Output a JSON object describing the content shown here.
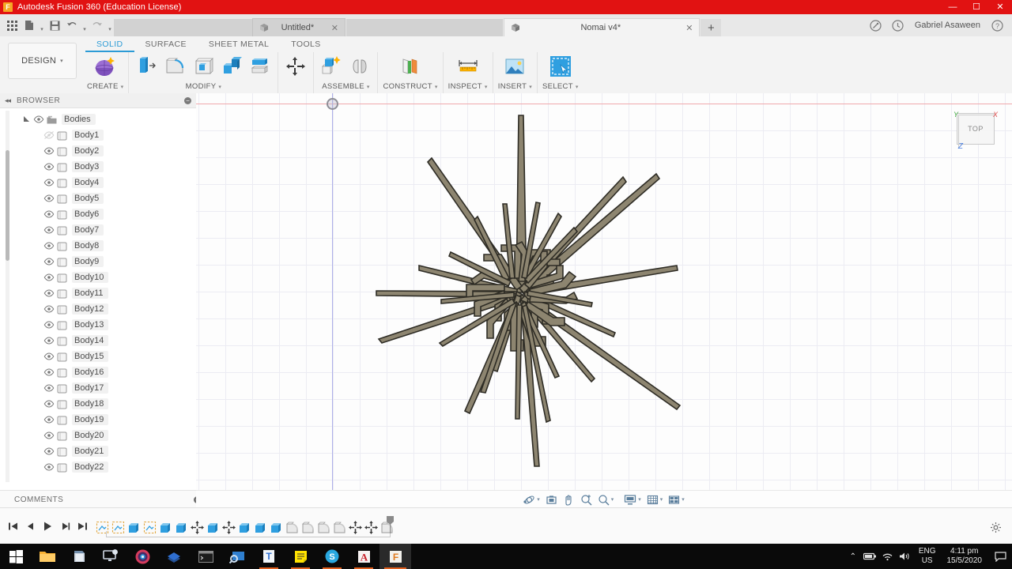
{
  "titlebar": {
    "app_title": "Autodesk Fusion 360 (Education License)",
    "app_icon": "fusion-logo-icon",
    "minimize": "—",
    "maximize": "☐",
    "close": "✕",
    "bg_color": "#e11212"
  },
  "quick_access": {
    "grid_menu": "grid-menu-icon",
    "file_label": "file-icon",
    "save_label": "save-icon",
    "undo_label": "undo-icon",
    "redo_label": "redo-icon",
    "tabs": [
      {
        "label": "Untitled*",
        "close": "✕",
        "active": false
      },
      {
        "label": "Nomai v4*",
        "close": "✕",
        "active": true
      }
    ],
    "new_tab": "+",
    "extensions_icon": "extensions-icon",
    "job_status_icon": "job-status-icon",
    "username": "Gabriel Asaween",
    "help_icon": "help-icon"
  },
  "ribbon": {
    "workspace": "DESIGN",
    "workspace_caret": "▾",
    "tabs": [
      {
        "label": "SOLID",
        "active": true
      },
      {
        "label": "SURFACE",
        "active": false
      },
      {
        "label": "SHEET METAL",
        "active": false
      },
      {
        "label": "TOOLS",
        "active": false
      }
    ],
    "panels": [
      {
        "label": "CREATE",
        "caret": "▾",
        "icons": [
          "create-sphere-icon"
        ]
      },
      {
        "label": "MODIFY",
        "caret": "▾",
        "icons": [
          "press-pull-icon",
          "fillet-icon",
          "shell-icon",
          "combine-icon",
          "split-body-icon"
        ]
      },
      {
        "label": "",
        "caret": "",
        "icons": [
          "move-copy-icon"
        ]
      },
      {
        "label": "ASSEMBLE",
        "caret": "▾",
        "icons": [
          "new-component-icon",
          "joint-icon"
        ]
      },
      {
        "label": "CONSTRUCT",
        "caret": "▾",
        "icons": [
          "offset-plane-icon"
        ]
      },
      {
        "label": "INSPECT",
        "caret": "▾",
        "icons": [
          "measure-icon"
        ]
      },
      {
        "label": "INSERT",
        "caret": "▾",
        "icons": [
          "insert-image-icon"
        ]
      },
      {
        "label": "SELECT",
        "caret": "▾",
        "icons": [
          "select-window-icon"
        ]
      }
    ],
    "accent_color": "#2c9bd6"
  },
  "browser": {
    "title": "BROWSER",
    "collapse_icon": "◂◂",
    "settings_icon": "⊖",
    "root": {
      "label": "Bodies",
      "expand_icon": "expand-triangle-icon",
      "eye_icon": "eye-icon",
      "folder_icon": "folder-icon"
    },
    "bodies": [
      {
        "label": "Body1",
        "visible": false
      },
      {
        "label": "Body2",
        "visible": true
      },
      {
        "label": "Body3",
        "visible": true
      },
      {
        "label": "Body4",
        "visible": true
      },
      {
        "label": "Body5",
        "visible": true
      },
      {
        "label": "Body6",
        "visible": true
      },
      {
        "label": "Body7",
        "visible": true
      },
      {
        "label": "Body8",
        "visible": true
      },
      {
        "label": "Body9",
        "visible": true
      },
      {
        "label": "Body10",
        "visible": true
      },
      {
        "label": "Body11",
        "visible": true
      },
      {
        "label": "Body12",
        "visible": true
      },
      {
        "label": "Body13",
        "visible": true
      },
      {
        "label": "Body14",
        "visible": true
      },
      {
        "label": "Body15",
        "visible": true
      },
      {
        "label": "Body16",
        "visible": true
      },
      {
        "label": "Body17",
        "visible": true
      },
      {
        "label": "Body18",
        "visible": true
      },
      {
        "label": "Body19",
        "visible": true
      },
      {
        "label": "Body20",
        "visible": true
      },
      {
        "label": "Body21",
        "visible": true
      },
      {
        "label": "Body22",
        "visible": true
      }
    ]
  },
  "comments": {
    "title": "COMMENTS",
    "add_icon": "+"
  },
  "canvas": {
    "view_cube_label": "TOP",
    "axis_x_label": "X",
    "axis_y_label": "Y",
    "axis_z_label": "Z",
    "axis_x_color": "#e05050",
    "axis_y_color": "#3faa3f",
    "axis_z_color": "#4a7fe0",
    "grid_color": "#ececf3",
    "model_fill": "#8d8570",
    "model_stroke": "#3a372e",
    "model_name": "nomai-radial-glyph"
  },
  "navbar": {
    "items": [
      {
        "name": "orbit-icon",
        "caret": "▾"
      },
      {
        "name": "look-at-icon",
        "caret": ""
      },
      {
        "name": "pan-icon",
        "caret": ""
      },
      {
        "name": "zoom-window-icon",
        "caret": ""
      },
      {
        "name": "zoom-icon",
        "caret": "▾"
      },
      {
        "name": "display-settings-icon",
        "caret": "▾"
      },
      {
        "name": "grid-snaps-icon",
        "caret": "▾"
      },
      {
        "name": "viewports-icon",
        "caret": "▾"
      }
    ]
  },
  "timeline": {
    "playback": [
      {
        "name": "go-to-beginning-button",
        "glyph": "⏮"
      },
      {
        "name": "step-back-button",
        "glyph": "◀"
      },
      {
        "name": "play-button",
        "glyph": "▶"
      },
      {
        "name": "step-forward-button",
        "glyph": "▶❘"
      },
      {
        "name": "go-to-end-button",
        "glyph": "⏭"
      }
    ],
    "features": [
      "sketch-feature",
      "sketch-feature",
      "extrude-feature",
      "sketch-feature",
      "extrude-feature",
      "extrude-feature",
      "move-feature",
      "extrude-feature",
      "move-feature",
      "extrude-feature",
      "extrude-feature",
      "extrude-feature",
      "fillet-feature",
      "fillet-feature",
      "fillet-feature",
      "fillet-feature",
      "move-feature",
      "move-feature",
      "fillet-feature"
    ],
    "end_marker": "timeline-end-marker"
  },
  "taskbar": {
    "start": "start-button",
    "items": [
      {
        "name": "file-explorer-icon",
        "state": "pinned"
      },
      {
        "name": "store-icon",
        "state": "pinned"
      },
      {
        "name": "teamviewer-icon",
        "state": "pinned"
      },
      {
        "name": "chrome-icon",
        "state": "pinned"
      },
      {
        "name": "inventor-icon",
        "state": "pinned"
      },
      {
        "name": "terminal-icon",
        "state": "pinned"
      },
      {
        "name": "search-app-icon",
        "state": "pinned"
      },
      {
        "name": "teams-icon",
        "state": "open"
      },
      {
        "name": "notes-icon",
        "state": "open"
      },
      {
        "name": "skype-icon",
        "state": "open"
      },
      {
        "name": "acrobat-icon",
        "state": "open"
      },
      {
        "name": "fusion360-icon",
        "state": "active"
      }
    ],
    "tray": {
      "chevron": "⌃",
      "icons": [
        "battery-icon",
        "wifi-icon",
        "volume-icon"
      ],
      "language_line1": "ENG",
      "language_line2": "US",
      "time": "4:11 pm",
      "date": "15/5/2020",
      "notifications": "notification-icon"
    }
  }
}
